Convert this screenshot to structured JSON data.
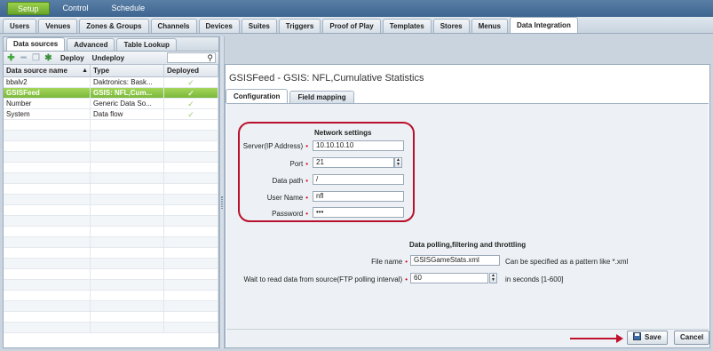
{
  "topnav": {
    "items": [
      "Setup",
      "Control",
      "Schedule"
    ],
    "active": 0
  },
  "module_tabs": [
    "Users",
    "Venues",
    "Zones & Groups",
    "Channels",
    "Devices",
    "Suites",
    "Triggers",
    "Proof of Play",
    "Templates",
    "Stores",
    "Menus",
    "Data Integration"
  ],
  "left": {
    "subtabs": [
      "Data sources",
      "Advanced",
      "Table Lookup"
    ],
    "toolbar": {
      "deploy": "Deploy",
      "undeploy": "Undeploy"
    },
    "columns": [
      "Data source name",
      "Type",
      "Deployed"
    ],
    "rows": [
      {
        "name": "bbalv2",
        "type": "Daktronics: Bask...",
        "deployed": "✓"
      },
      {
        "name": "GSISFeed",
        "type": "GSIS: NFL,Cum...",
        "deployed": "✓"
      },
      {
        "name": "Number",
        "type": "Generic Data So...",
        "deployed": "✓"
      },
      {
        "name": "System",
        "type": "Data flow",
        "deployed": "✓"
      }
    ]
  },
  "right": {
    "title": "GSISFeed - GSIS: NFL,Cumulative Statistics",
    "tabs": [
      "Configuration",
      "Field mapping"
    ],
    "network": {
      "title": "Network settings",
      "server_label": "Server(IP Address)",
      "server_value": "10.10.10.10",
      "port_label": "Port",
      "port_value": "21",
      "path_label": "Data path",
      "path_value": "/",
      "user_label": "User Name",
      "user_value": "nfl",
      "password_label": "Password",
      "password_value": "•••"
    },
    "polling": {
      "title": "Data polling,filtering and throttling",
      "file_label": "File name",
      "file_value": "GSISGameStats.xml",
      "file_hint": "Can be specified as a pattern like *.xml",
      "wait_label": "Wait to read data from source(FTP polling interval)",
      "wait_value": "60",
      "wait_hint": "in seconds [1-600]"
    },
    "save": "Save",
    "cancel": "Cancel"
  }
}
